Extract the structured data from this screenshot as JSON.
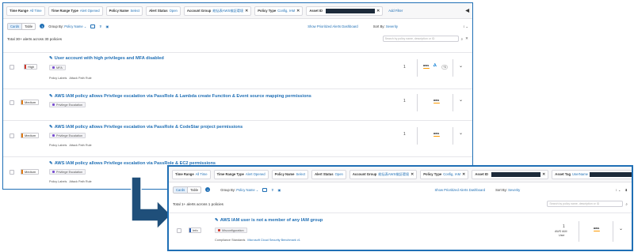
{
  "before": {
    "filters": [
      {
        "key": "Time Range",
        "value": "All Time",
        "closable": false
      },
      {
        "key": "Time Range Type",
        "value": "Alert Opened",
        "closable": false
      },
      {
        "key": "Policy Name",
        "value": "Select",
        "closable": false
      },
      {
        "key": "Alert Status",
        "value": "Open",
        "closable": false
      },
      {
        "key": "Account Group",
        "value": "総括表AWS検証環境",
        "closable": true
      },
      {
        "key": "Policy Type",
        "value": "Config, IAM",
        "closable": true
      },
      {
        "key": "Asset ID",
        "value": "",
        "closable": true,
        "redacted": true
      }
    ],
    "add_filter": "Add Filter",
    "view_cards": "Cards",
    "view_table": "Table",
    "group_by_label": "Group By:",
    "group_by_value": "Policy Name",
    "prioritized_link": "Show Prioritized Alerts Dashboard",
    "sort_by_label": "Sort By:",
    "sort_by_value": "Severity",
    "summary": "Total 30+ alerts across 30 policies",
    "search_placeholder": "Search by policy name, description or ID",
    "alerts": [
      {
        "severity": "High",
        "title": "User account with high privileges and MFA disabled",
        "tag": "MFA",
        "labels_label": "Policy Labels",
        "labels_value": "Attack Path Rule",
        "count": "1",
        "cloud": "aws",
        "extra": "+6",
        "azure": true
      },
      {
        "severity": "Medium",
        "title": "AWS IAM policy allows Privilege escalation via PassRole & Lambda create Function & Event source mapping permissions",
        "tag": "Privilege Escalation",
        "labels_label": "",
        "labels_value": "",
        "count": "1",
        "cloud": "aws"
      },
      {
        "severity": "Medium",
        "title": "AWS IAM policy allows Privilege escalation via PassRole & CodeStar project permissions",
        "tag": "Privilege Escalation",
        "labels_label": "Policy Labels",
        "labels_value": "Attack Path Rule",
        "count": "1",
        "cloud": "aws"
      },
      {
        "severity": "Medium",
        "title": "AWS IAM policy allows Privilege escalation via PassRole & EC2 permissions",
        "tag": "Privilege Escalation",
        "labels_label": "Policy Labels",
        "labels_value": "Attack Path Rule",
        "count": "1",
        "cloud": "aws"
      }
    ]
  },
  "after": {
    "filters": [
      {
        "key": "Time Range",
        "value": "All Time",
        "closable": false
      },
      {
        "key": "Time Range Type",
        "value": "Alert Opened",
        "closable": false
      },
      {
        "key": "Policy Name",
        "value": "Select",
        "closable": false
      },
      {
        "key": "Alert Status",
        "value": "Open",
        "closable": false
      },
      {
        "key": "Account Group",
        "value": "総括表AWS検証環境",
        "closable": true
      },
      {
        "key": "Policy Type",
        "value": "Config, IAM",
        "closable": true
      },
      {
        "key": "Asset ID",
        "value": "",
        "closable": true,
        "redacted": true
      },
      {
        "key": "Asset Tag",
        "value": "UserName",
        "closable": true,
        "redacted": true
      }
    ],
    "add_filter": "Add Filter",
    "view_cards": "Cards",
    "view_table": "Table",
    "group_by_label": "Group By:",
    "group_by_value": "Policy Name",
    "prioritized_link": "Show Prioritized Alerts Dashboard",
    "sort_by_label": "Sort By:",
    "sort_by_value": "Severity",
    "summary": "Total 1+ alerts across 1 policies",
    "search_placeholder": "Search by policy name, description or ID",
    "alert": {
      "severity": "Info",
      "title": "AWS IAM user is not a member of any IAM group",
      "tag": "Misconfiguration",
      "labels_label": "Compliance Standards",
      "labels_value": "Microsoft Cloud Security Benchmark v1",
      "count": "1",
      "account": "AWS IAM",
      "account_sub": "User",
      "cloud": "aws"
    }
  },
  "colors": {
    "accent": "#1f6fb5",
    "arrow": "#1f4f7a",
    "high": "#d0382b",
    "medium": "#e07b16",
    "info": "#2c5fb3"
  }
}
